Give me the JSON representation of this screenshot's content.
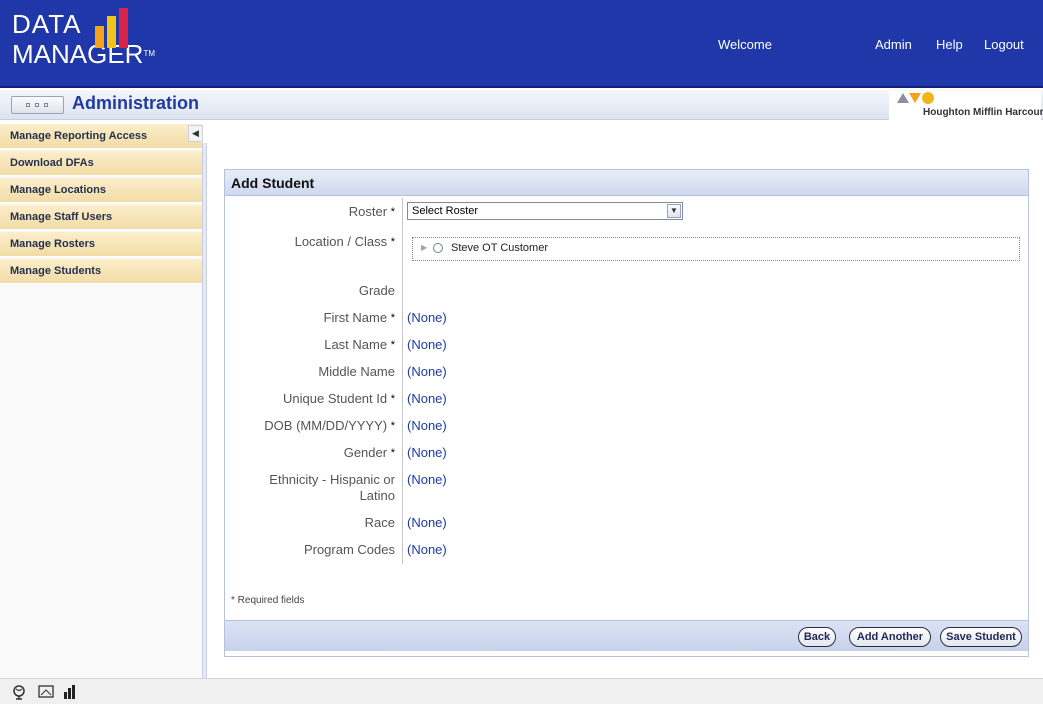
{
  "header": {
    "logo_line1": "DATA",
    "logo_line2": "MANAGER",
    "logo_tm": "TM",
    "welcome": "Welcome",
    "admin": "Admin",
    "help": "Help",
    "logout": "Logout",
    "colors": {
      "background": "#1f37a8",
      "bar1": "#f5a21b",
      "bar2": "#f0c419",
      "bar3": "#d9234a"
    }
  },
  "titlebar": {
    "title": "Administration",
    "publisher": "Houghton Mifflin Harcourt"
  },
  "sidebar": {
    "items": [
      {
        "label": "Manage Reporting Access"
      },
      {
        "label": "Download DFAs"
      },
      {
        "label": "Manage Locations"
      },
      {
        "label": "Manage Staff Users"
      },
      {
        "label": "Manage Rosters"
      },
      {
        "label": "Manage Students"
      }
    ]
  },
  "form": {
    "title": "Add Student",
    "roster_label": "Roster",
    "roster_value": "Select Roster",
    "location_label": "Location / Class",
    "location_tree_item": "Steve OT Customer",
    "grade_label": "Grade",
    "fields": [
      {
        "label": "First Name",
        "required": "*",
        "value": "(None)"
      },
      {
        "label": "Last Name",
        "required": "*",
        "value": "(None)"
      },
      {
        "label": "Middle Name",
        "required": "",
        "value": "(None)"
      },
      {
        "label": "Unique Student Id",
        "required": "*",
        "value": "(None)"
      },
      {
        "label": "DOB (MM/DD/YYYY)",
        "required": "*",
        "value": "(None)"
      },
      {
        "label": "Gender",
        "required": "*",
        "value": "(None)"
      },
      {
        "label": "Ethnicity - Hispanic or Latino",
        "required": "",
        "value": "(None)"
      },
      {
        "label": "Race",
        "required": "",
        "value": "(None)"
      },
      {
        "label": "Program Codes",
        "required": "",
        "value": "(None)"
      }
    ],
    "required_star": "*",
    "required_note": "* Required fields",
    "buttons": {
      "back": "Back",
      "add_another": "Add Another",
      "save": "Save Student"
    }
  },
  "bottombar": {
    "icons": [
      "globe-icon",
      "monitor-icon",
      "chart-icon"
    ]
  }
}
